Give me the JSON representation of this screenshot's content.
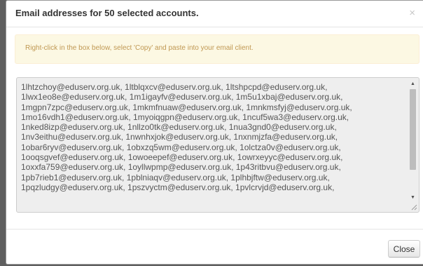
{
  "dialog": {
    "title": "Email addresses for 50 selected accounts.",
    "close_symbol": "×"
  },
  "alert": {
    "message": "Right-click in the box below, select 'Copy' and paste into your email client."
  },
  "email_box": {
    "lines": [
      "1lhtzchoy@eduserv.org.uk, 1ltblqxcv@eduserv.org.uk, 1ltshpcpd@eduserv.org.uk,",
      "1lwx1eo8e@eduserv.org.uk, 1m1igayfv@eduserv.org.uk, 1m5u1xbaj@eduserv.org.uk,",
      "1mgpn7zpc@eduserv.org.uk, 1mkmfnuaw@eduserv.org.uk, 1mnkmsfyj@eduserv.org.uk,",
      "1mo16vdh1@eduserv.org.uk, 1myoiqgpn@eduserv.org.uk, 1ncuf5wa3@eduserv.org.uk,",
      "1nked8izp@eduserv.org.uk, 1nllzo0tk@eduserv.org.uk, 1nua3gnd0@eduserv.org.uk,",
      "1nv3eithu@eduserv.org.uk, 1nwnhxjok@eduserv.org.uk, 1nxnmjzfa@eduserv.org.uk,",
      "1obar6ryv@eduserv.org.uk, 1obxzq5wm@eduserv.org.uk, 1olctza0v@eduserv.org.uk,",
      "1ooqsgvef@eduserv.org.uk, 1owoeepef@eduserv.org.uk, 1owrxeyyc@eduserv.org.uk,",
      "1oxxfa759@eduserv.org.uk, 1oyllwpmp@eduserv.org.uk, 1p43ritbvu@eduserv.org.uk,",
      "1pb7rieb1@eduserv.org.uk, 1pblniaqv@eduserv.org.uk, 1plhbjftw@eduserv.org.uk,",
      "1pqzludgy@eduserv.org.uk, 1pszvyctm@eduserv.org.uk, 1pvlcrvjd@eduserv.org.uk,"
    ],
    "scroll_position": 0,
    "visible_fraction": 0.78
  },
  "footer": {
    "close_label": "Close"
  },
  "icons": {
    "scroll_up": "▲",
    "scroll_down": "▼"
  },
  "colors": {
    "alert_background": "#fcf8e3",
    "alert_text": "#c09853",
    "textarea_background": "#eeeeee",
    "backdrop": "#5f5f5f"
  }
}
